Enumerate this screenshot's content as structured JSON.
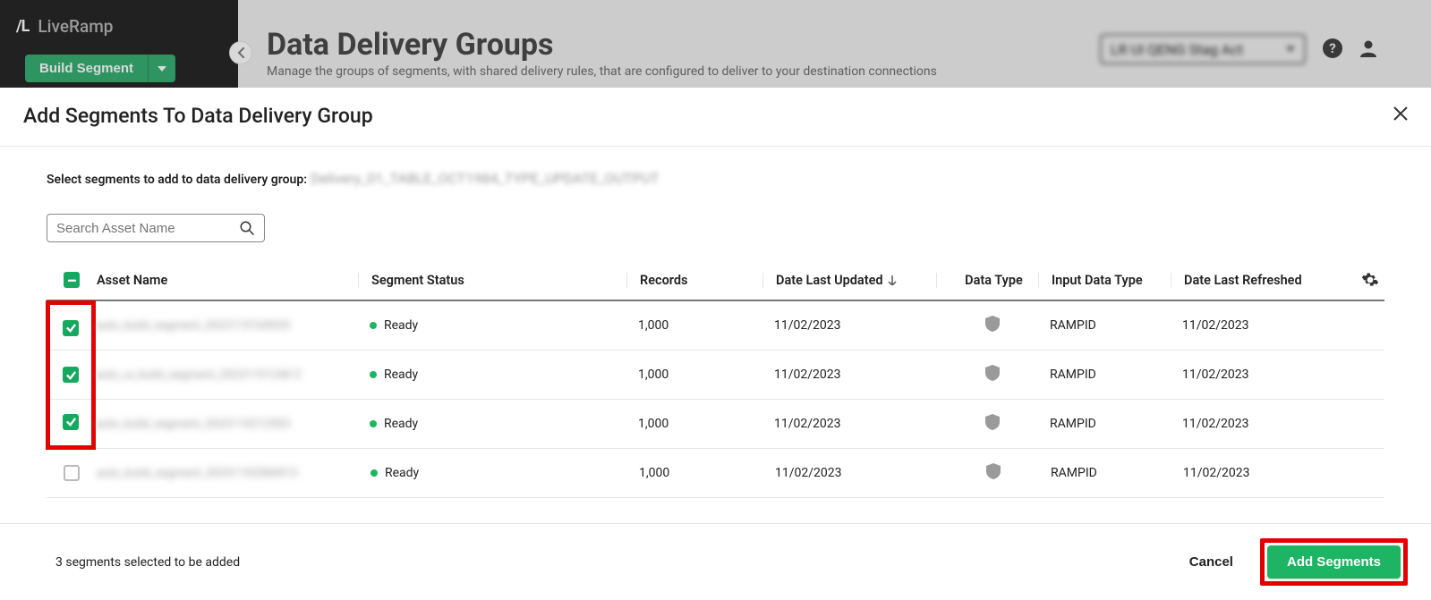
{
  "bg": {
    "brand": "LiveRamp",
    "logo_mark": "/L",
    "build_segment": "Build Segment",
    "page_title": "Data Delivery Groups",
    "page_subtitle": "Manage the groups of segments, with shared delivery rules, that are configured to deliver to your destination connections",
    "account_selected": "LR UI QENG Stag Act"
  },
  "modal": {
    "title": "Add Segments To Data Delivery Group",
    "instruction_prefix": "Select segments to add to data delivery group:",
    "group_name": "Delivery_01_TABLE_OCT1984_TYPE_UPDATE_OUTPUT",
    "search_placeholder": "Search Asset Name"
  },
  "columns": {
    "asset_name": "Asset Name",
    "segment_status": "Segment Status",
    "records": "Records",
    "date_last_updated": "Date Last Updated",
    "data_type": "Data Type",
    "input_data_type": "Input Data Type",
    "date_last_refreshed": "Date Last Refreshed"
  },
  "rows": [
    {
      "checked": true,
      "highlighted": true,
      "name": "auto_build_segment_2023110104920",
      "status": "Ready",
      "records": "1,000",
      "updated": "11/02/2023",
      "input": "RAMPID",
      "refreshed": "11/02/2023"
    },
    {
      "checked": true,
      "highlighted": true,
      "name": "auto_ui_build_segment_20231101240 5",
      "status": "Ready",
      "records": "1,000",
      "updated": "11/02/2023",
      "input": "RAMPID",
      "refreshed": "11/02/2023"
    },
    {
      "checked": true,
      "highlighted": true,
      "name": "auto_build_segment_2023110212503",
      "status": "Ready",
      "records": "1,000",
      "updated": "11/02/2023",
      "input": "RAMPID",
      "refreshed": "11/02/2023"
    },
    {
      "checked": false,
      "highlighted": false,
      "name": "auto_build_segment_20231102084913",
      "status": "Ready",
      "records": "1,000",
      "updated": "11/02/2023",
      "input": "RAMPID",
      "refreshed": "11/02/2023"
    }
  ],
  "footer": {
    "selection_text": "3 segments selected to be added",
    "cancel": "Cancel",
    "add": "Add Segments"
  }
}
